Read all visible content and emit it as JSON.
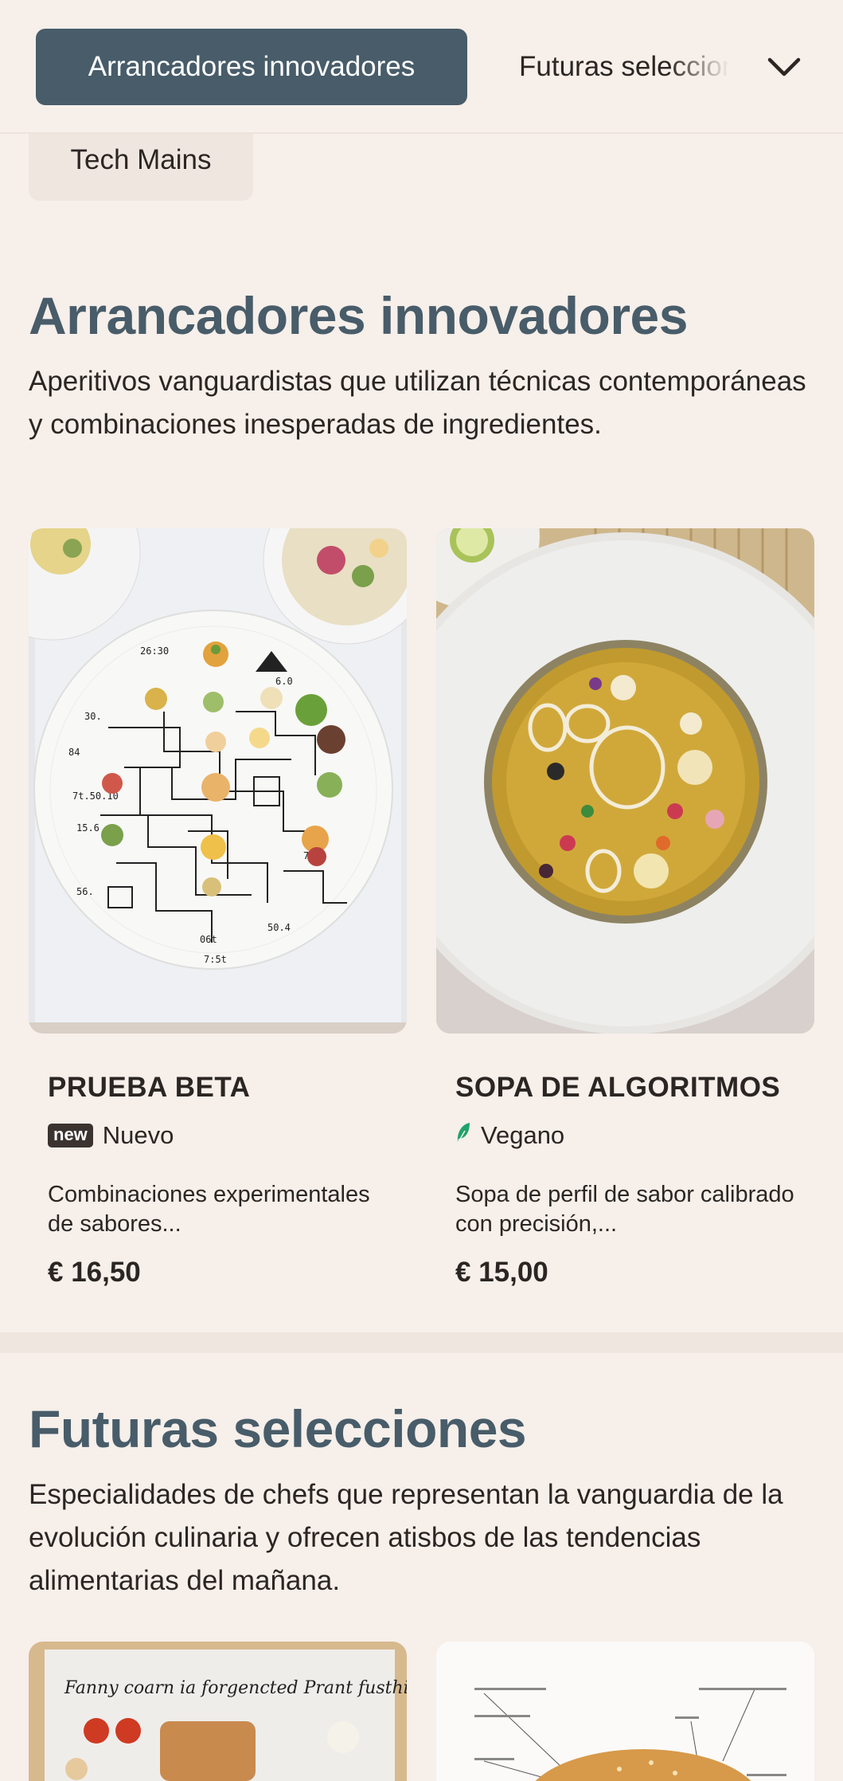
{
  "nav": {
    "active_category": "Arrancadores innovadores",
    "next_category": "Futuras selecciones",
    "extra_category": "Tech Mains"
  },
  "sections": [
    {
      "title": "Arrancadores innovadores",
      "description": "Aperitivos vanguardistas que utilizan técnicas contemporáneas y combinaciones inesperadas de ingredientes.",
      "items": [
        {
          "name": "PRUEBA BETA",
          "badge": "new",
          "tag": "Nuevo",
          "description": "Combinaciones experimentales de sabores...",
          "price": "€ 16,50"
        },
        {
          "name": "SOPA DE ALGORITMOS",
          "tag": "Vegano",
          "tag_icon": "leaf-icon",
          "description": "Sopa de perfil de sabor calibrado con precisión,...",
          "price": "€ 15,00"
        }
      ]
    },
    {
      "title": "Futuras selecciones",
      "description": "Especialidades de chefs que representan la vanguardia de la evolución culinaria y ofrecen atisbos de las tendencias alimentarias del mañana.",
      "items": [
        {
          "image_caption": "Fanny coarn ia forgencted Prant fusthing"
        },
        {
          "image_caption": ""
        }
      ]
    }
  ],
  "colors": {
    "accent": "#485c69",
    "background": "#f6efea",
    "text": "#2b2623",
    "vegan_green": "#1fa36b"
  }
}
